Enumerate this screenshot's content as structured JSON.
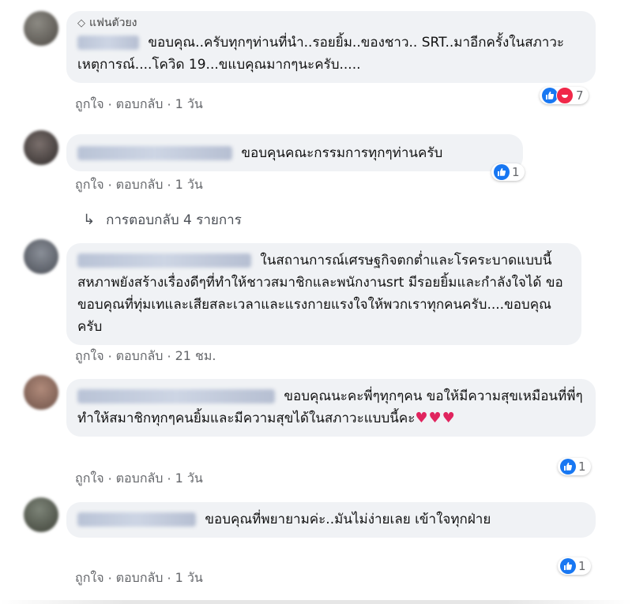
{
  "fan_badge": "แฟนตัวยง",
  "action_like": "ถูกใจ",
  "action_reply": "ตอบกลับ",
  "colors": {
    "like_blue": "#1877f2",
    "haha_red": "#f02849",
    "bubble_bg": "#f0f2f5",
    "heart": "#e0245e"
  },
  "comments": [
    {
      "text": "ขอบคุณ..ครับทุกๆท่านที่นำ..รอยยิ้ม..ของชาว.. SRT..มาอีกครั้งในสภาวะเหตุการณ์....โควิด 19...ขแบคุณมากๆนะครับ.....",
      "time": "1 วัน",
      "reactions": [
        "like-icon",
        "haha-icon"
      ],
      "reaction_count": "7"
    },
    {
      "text": "ขอบคุนคณะกรรมการทุกๆท่านครับ",
      "time": "1 วัน",
      "reactions": [
        "like-icon"
      ],
      "reaction_count": "1"
    },
    {
      "text": "ในสถานการณ์เศรษฐกิจตกต่ำและโรคระบาดแบบนี้ สหภาพยังสร้างเรื่องดีๆที่ทำให้ชาวสมาชิกและพนักงานsrt มีรอยยิ้มและกำลังใจได้ ขอขอบคุณที่ทุ่มเทและเสียสละเวลาและแรงกายแรงใจให้พวกเราทุกคนครับ....ขอบคุณครับ",
      "time": "21 ชม.",
      "reactions": [],
      "reaction_count": ""
    },
    {
      "text": "ขอบคุณนะคะพี่ๆทุกๆคน ขอให้มีความสุขเหมือนที่พี่ๆทำให้สมาชิกทุกๆคนยิ้มและมีความสุขได้ในสภาวะแบบนี้คะ",
      "hearts": "♥♥♥",
      "time": "1 วัน",
      "reactions": [
        "like-icon"
      ],
      "reaction_count": "1"
    },
    {
      "text": "ขอบคุณที่พยายามค่ะ..มันไม่ง่ายเลย เข้าใจทุกฝ่าย",
      "time": "1 วัน",
      "reactions": [
        "like-icon"
      ],
      "reaction_count": "1"
    }
  ],
  "replies_link": "การตอบกลับ 4 รายการ",
  "replies_arrow_icon": "reply-arrow-icon"
}
